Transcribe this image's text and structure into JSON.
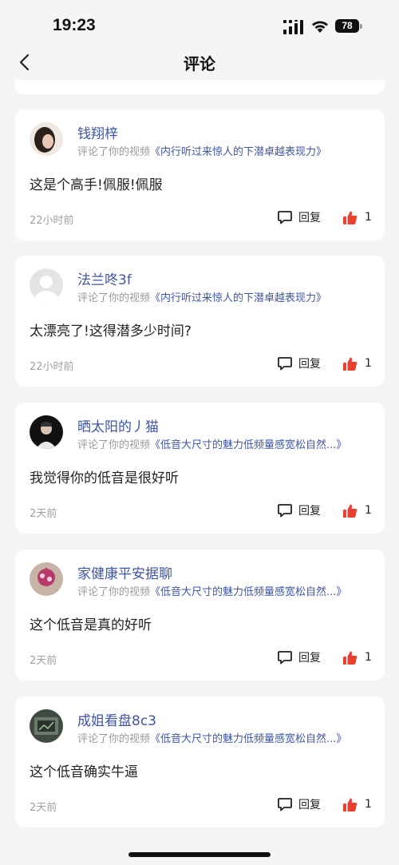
{
  "status_bar": {
    "time": "19:23",
    "battery": "78"
  },
  "nav": {
    "title": "评论",
    "back_icon": "chevron-left-icon"
  },
  "comments": [
    {
      "username": "钱翔梓",
      "action": "评论了你的视频",
      "video_title": "《内行听过来惊人的下潜卓越表现力》",
      "text": "这是个高手!佩服!佩服",
      "time": "22小时前",
      "reply_label": "回复",
      "likes": "1",
      "avatar_color": "#e8ddd2"
    },
    {
      "username": "法兰咚3f",
      "action": "评论了你的视频",
      "video_title": "《内行听过来惊人的下潜卓越表现力》",
      "text": "太漂亮了!这得潜多少时间?",
      "time": "22小时前",
      "reply_label": "回复",
      "likes": "1",
      "avatar_color": "#e2e2e2"
    },
    {
      "username": "晒太阳的丿猫",
      "action": "评论了你的视频",
      "video_title": "《低音大尺寸的魅力低频量感宽松自然...》",
      "text": "我觉得你的低音是很好听",
      "time": "2天前",
      "reply_label": "回复",
      "likes": "1",
      "avatar_color": "#111111"
    },
    {
      "username": "家健康平安据聊",
      "action": "评论了你的视频",
      "video_title": "《低音大尺寸的魅力低频量感宽松自然...》",
      "text": "这个低音是真的好听",
      "time": "2天前",
      "reply_label": "回复",
      "likes": "1",
      "avatar_color": "#c9b6a8"
    },
    {
      "username": "成姐看盘8c3",
      "action": "评论了你的视频",
      "video_title": "《低音大尺寸的魅力低频量感宽松自然...》",
      "text": "这个低音确实牛逼",
      "time": "2天前",
      "reply_label": "回复",
      "likes": "1",
      "avatar_color": "#4e5a4f"
    }
  ],
  "colors": {
    "link": "#3e55a4",
    "like": "#e8412f",
    "background": "#f4f5f7"
  }
}
